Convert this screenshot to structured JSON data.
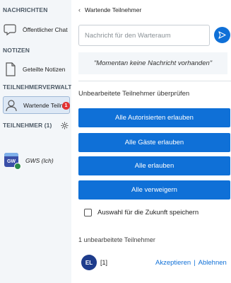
{
  "sidebar": {
    "messages_title": "NACHRICHTEN",
    "public_chat": "Öffentlicher Chat",
    "notes_title": "NOTIZEN",
    "shared_notes": "Geteilte Notizen",
    "participant_mgmt_title": "TEILNEHMERVERWALTUNG",
    "waiting_users": "Wartende Teilnehmer",
    "waiting_users_badge": "1",
    "participants_title": "TEILNEHMER (1)",
    "user_avatar_text": "GW",
    "user_name": "GWS (Ich)"
  },
  "main": {
    "back_label": "Wartende Teilnehmer",
    "message_placeholder": "Nachricht für den Warteraum",
    "no_message": "\"Momentan keine Nachricht vorhanden\"",
    "review_title": "Unbearbeitete Teilnehmer überprüfen",
    "buttons": {
      "allow_authenticated": "Alle Autorisierten erlauben",
      "allow_guests": "Alle Gäste erlauben",
      "allow_all": "Alle erlauben",
      "deny_all": "Alle verweigern"
    },
    "remember_choice": "Auswahl für die Zukunft speichern",
    "pending_count": "1 unbearbeitete Teilnehmer",
    "pending_user": {
      "avatar": "EL",
      "name": "[1]"
    },
    "accept": "Akzeptieren",
    "separator": "|",
    "reject": "Ablehnen"
  },
  "colors": {
    "primary": "#0f70d7",
    "sidebar_bg": "#f3f6f9",
    "badge": "#e23333",
    "user_avatar": "#1e3c8c"
  },
  "icons": [
    "chat-icon",
    "notes-icon",
    "user-icon",
    "gear-icon",
    "send-icon",
    "chevron-left-icon"
  ]
}
